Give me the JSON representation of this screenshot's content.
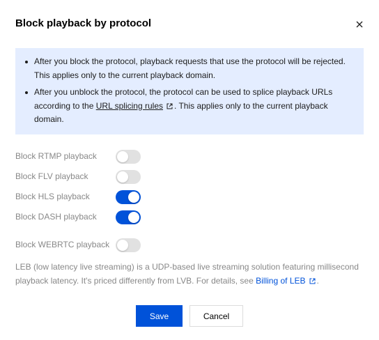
{
  "dialog": {
    "title": "Block playback by protocol",
    "close_icon": "close-icon"
  },
  "notice": {
    "item1": "After you block the protocol, playback requests that use the protocol will be rejected. This applies only to the current playback domain.",
    "item2_before": "After you unblock the protocol, the protocol can be used to splice playback URLs according to the ",
    "item2_link": "URL splicing rules",
    "item2_after": ". This applies only to the current playback domain."
  },
  "toggles": [
    {
      "label": "Block RTMP playback",
      "on": false
    },
    {
      "label": "Block FLV playback",
      "on": false
    },
    {
      "label": "Block HLS playback",
      "on": true
    },
    {
      "label": "Block DASH playback",
      "on": true
    },
    {
      "label": "Block WEBRTC playback",
      "on": false
    }
  ],
  "leb_note": {
    "text": "LEB (low latency live streaming) is a UDP-based live streaming solution featuring millisecond playback latency. It's priced differently from LVB. For details, see ",
    "link": "Billing of LEB",
    "after": "."
  },
  "buttons": {
    "save": "Save",
    "cancel": "Cancel"
  },
  "colors": {
    "accent": "#0052d9",
    "notice_bg": "#e4edff",
    "toggle_off": "#e1e1e1"
  }
}
